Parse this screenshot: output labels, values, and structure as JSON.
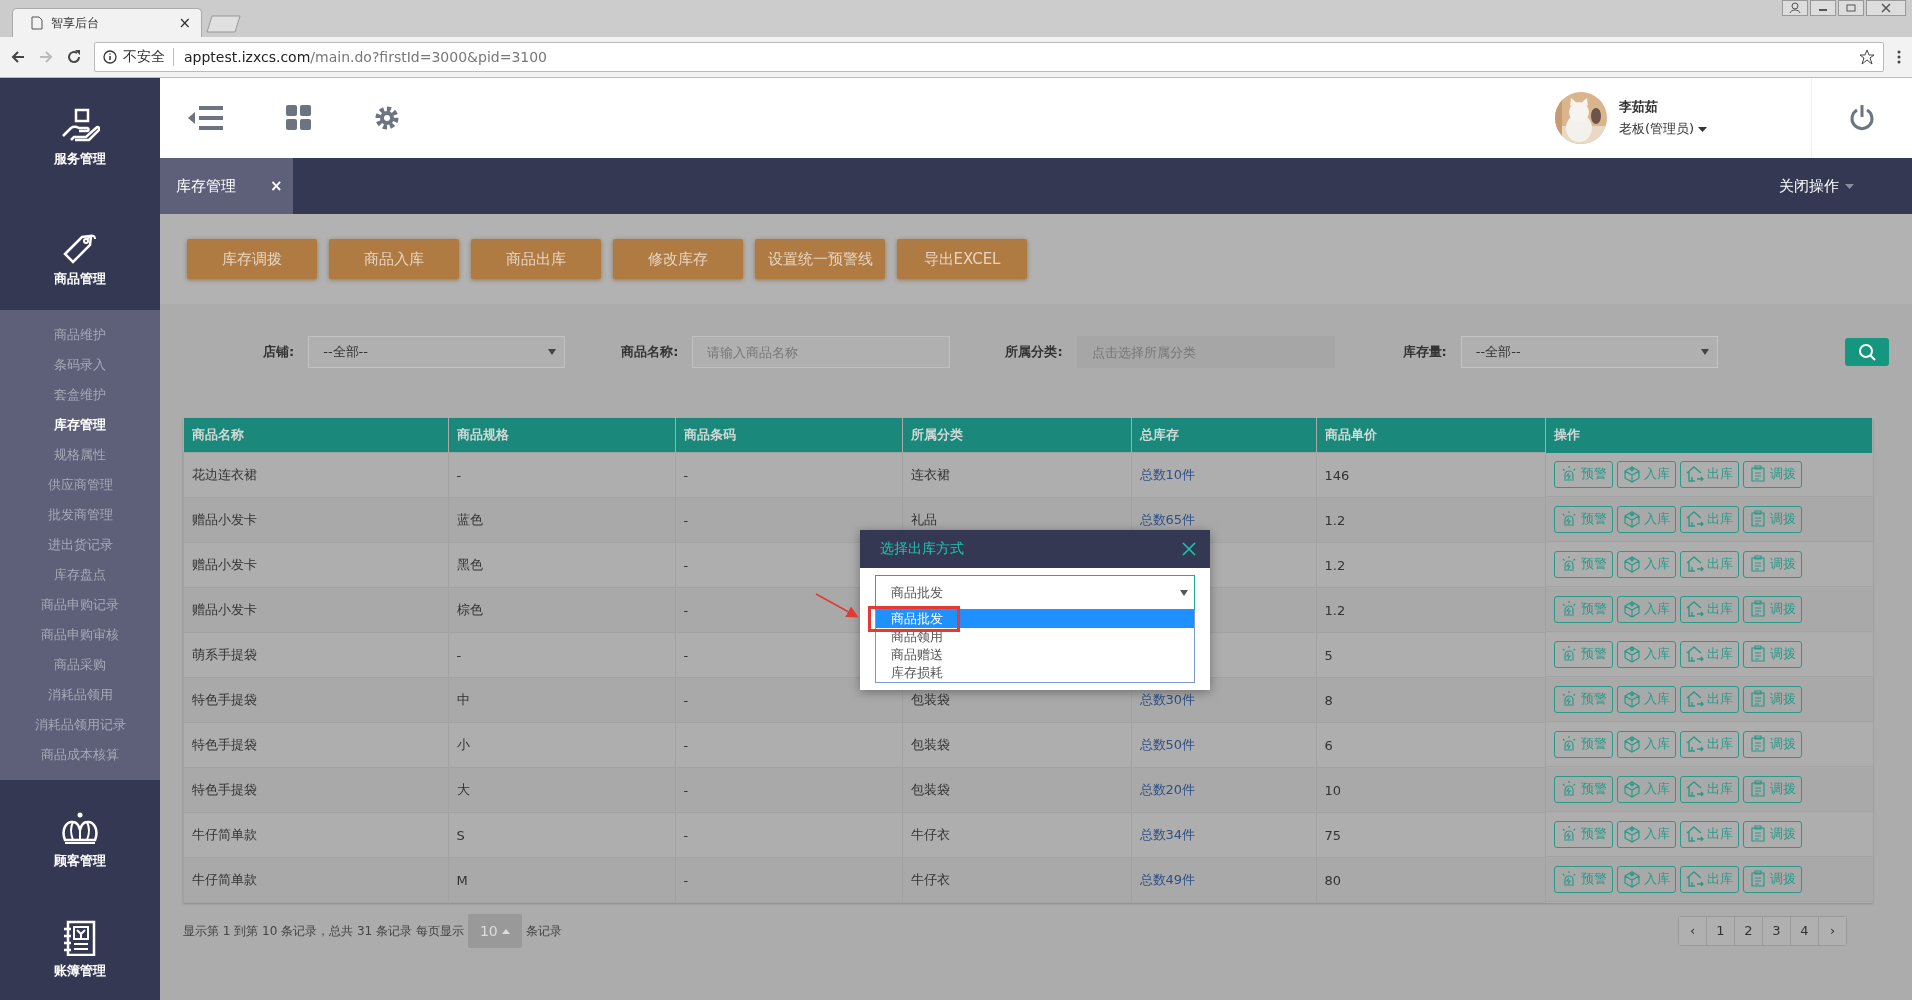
{
  "browser": {
    "tab_title": "智享后台",
    "tab_close": "×",
    "security_label": "不安全",
    "url_host": "apptest.izxcs.com",
    "url_path": "/main.do?firstId=3000&pid=3100"
  },
  "sidebar": {
    "groups": [
      {
        "kind": "service",
        "label": "服务管理"
      },
      {
        "kind": "goods",
        "label": "商品管理",
        "children": [
          {
            "label": "商品维护",
            "selected": false
          },
          {
            "label": "条码录入",
            "selected": false
          },
          {
            "label": "套盒维护",
            "selected": false
          },
          {
            "label": "库存管理",
            "selected": true
          },
          {
            "label": "规格属性",
            "selected": false
          },
          {
            "label": "供应商管理",
            "selected": false
          },
          {
            "label": "批发商管理",
            "selected": false
          },
          {
            "label": "进出货记录",
            "selected": false
          },
          {
            "label": "库存盘点",
            "selected": false
          },
          {
            "label": "商品申购记录",
            "selected": false
          },
          {
            "label": "商品申购审核",
            "selected": false
          },
          {
            "label": "商品采购",
            "selected": false
          },
          {
            "label": "消耗品领用",
            "selected": false
          },
          {
            "label": "消耗品领用记录",
            "selected": false
          },
          {
            "label": "商品成本核算",
            "selected": false
          }
        ]
      },
      {
        "kind": "customer",
        "label": "顾客管理"
      },
      {
        "kind": "ledger",
        "label": "账簿管理"
      }
    ]
  },
  "header": {
    "user_name": "李茹茹",
    "user_role": "老板(管理员)"
  },
  "tabs": [
    {
      "label": "库存管理",
      "selected": true,
      "close": "×"
    }
  ],
  "close_operations": "关闭操作",
  "toolbar_buttons": [
    "库存调拨",
    "商品入库",
    "商品出库",
    "修改库存",
    "设置统一预警线",
    "导出EXCEL"
  ],
  "filters": [
    {
      "kind": "select",
      "label": "店铺:",
      "value": "--全部--"
    },
    {
      "kind": "input",
      "label": "商品名称:",
      "placeholder": "请输入商品名称"
    },
    {
      "kind": "picker",
      "label": "所属分类:",
      "placeholder": "点击选择所属分类"
    },
    {
      "kind": "select",
      "label": "库存量:",
      "value": "--全部--"
    }
  ],
  "table": {
    "columns": [
      {
        "label": "商品名称",
        "kind": "text"
      },
      {
        "label": "商品规格",
        "kind": "text"
      },
      {
        "label": "商品条码",
        "kind": "text"
      },
      {
        "label": "所属分类",
        "kind": "text"
      },
      {
        "label": "总库存",
        "kind": "link"
      },
      {
        "label": "商品单价",
        "kind": "text"
      },
      {
        "label": "操作",
        "kind": "actions"
      }
    ],
    "rows": [
      {
        "name": "花边连衣裙",
        "spec": "-",
        "barcode": "-",
        "category": "连衣裙",
        "stock": "总数10件",
        "price": "146",
        "actions": [
          "预警",
          "入库",
          "出库",
          "调拨"
        ]
      },
      {
        "name": "赠品小发卡",
        "spec": "蓝色",
        "barcode": "-",
        "category": "礼品",
        "stock": "总数65件",
        "price": "1.2",
        "actions": [
          "预警",
          "入库",
          "出库",
          "调拨"
        ]
      },
      {
        "name": "赠品小发卡",
        "spec": "黑色",
        "barcode": "-",
        "price": "1.2",
        "actions": [
          "预警",
          "入库",
          "出库",
          "调拨"
        ]
      },
      {
        "name": "赠品小发卡",
        "spec": "棕色",
        "barcode": "-",
        "price": "1.2",
        "actions": [
          "预警",
          "入库",
          "出库",
          "调拨"
        ]
      },
      {
        "name": "萌系手提袋",
        "spec": "-",
        "barcode": "-",
        "price": "5",
        "actions": [
          "预警",
          "入库",
          "出库",
          "调拨"
        ]
      },
      {
        "name": "特色手提袋",
        "spec": "中",
        "barcode": "-",
        "category": "包装袋",
        "stock": "总数30件",
        "price": "8",
        "actions": [
          "预警",
          "入库",
          "出库",
          "调拨"
        ]
      },
      {
        "name": "特色手提袋",
        "spec": "小",
        "barcode": "-",
        "category": "包装袋",
        "stock": "总数50件",
        "price": "6",
        "actions": [
          "预警",
          "入库",
          "出库",
          "调拨"
        ]
      },
      {
        "name": "特色手提袋",
        "spec": "大",
        "barcode": "-",
        "category": "包装袋",
        "stock": "总数20件",
        "price": "10",
        "actions": [
          "预警",
          "入库",
          "出库",
          "调拨"
        ]
      },
      {
        "name": "牛仔简单款",
        "spec": "S",
        "barcode": "-",
        "category": "牛仔衣",
        "stock": "总数34件",
        "price": "75",
        "actions": [
          "预警",
          "入库",
          "出库",
          "调拨"
        ]
      },
      {
        "name": "牛仔简单款",
        "spec": "M",
        "barcode": "-",
        "category": "牛仔衣",
        "stock": "总数49件",
        "price": "80",
        "actions": [
          "预警",
          "入库",
          "出库",
          "调拨"
        ]
      }
    ]
  },
  "pagination": {
    "summary": "显示第 1 到第 10 条记录，总共 31 条记录 每页显示",
    "page_size": "10",
    "suffix": "条记录",
    "prev": "‹",
    "next": "›",
    "pages": [
      {
        "label": "1",
        "selected": false
      },
      {
        "label": "2",
        "selected": false
      },
      {
        "label": "3",
        "selected": false
      },
      {
        "label": "4",
        "selected": false
      }
    ]
  },
  "modal": {
    "title": "选择出库方式",
    "value": "商品批发",
    "options": [
      {
        "label": "商品批发",
        "selected": true,
        "highlighted": true
      },
      {
        "label": "商品领用",
        "selected": false,
        "highlighted": false
      },
      {
        "label": "商品赠送",
        "selected": false,
        "highlighted": false
      },
      {
        "label": "库存损耗",
        "selected": false,
        "highlighted": false
      }
    ]
  }
}
